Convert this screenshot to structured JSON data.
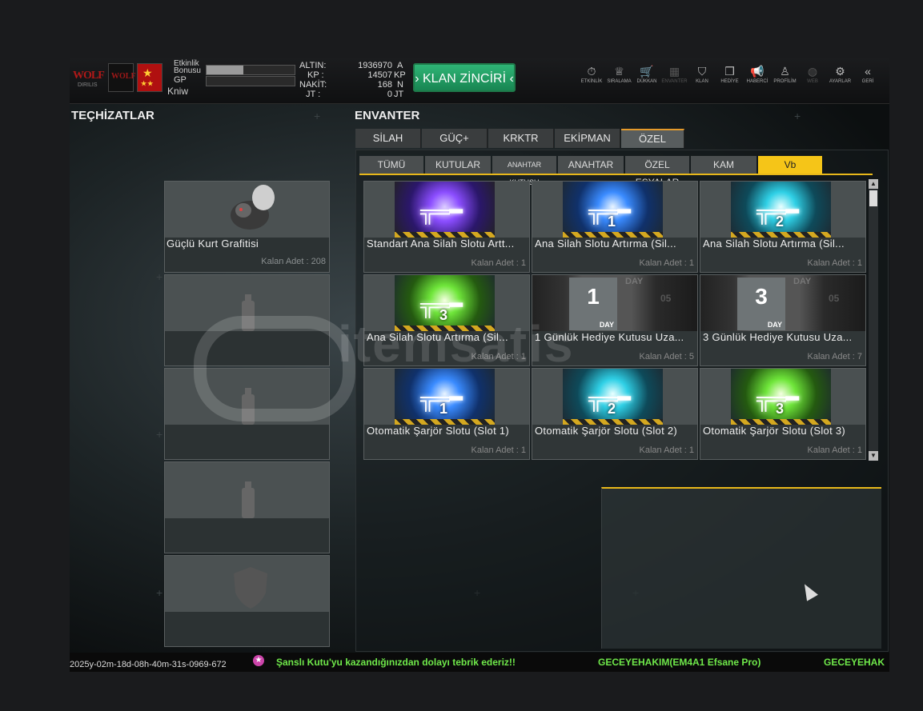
{
  "topbar": {
    "logo_text": "WOLF",
    "logo_sub": "DIRILIS",
    "logo2_text": "WOLF",
    "bonus_label": "Etkinlik Bonusu",
    "gp_label": "GP",
    "username": "Kniw",
    "bonus_progress": 0.42,
    "gp_progress": 0.0,
    "currencies": [
      {
        "label": "ALTIN:",
        "value": "1936970",
        "unit": "A"
      },
      {
        "label": "KP :",
        "value": "14507",
        "unit": "KP"
      },
      {
        "label": "NAKİT:",
        "value": "168",
        "unit": "N"
      },
      {
        "label": "JT :",
        "value": "0",
        "unit": "JT"
      }
    ],
    "klan_button": "› KLAN ZİNCİRİ ‹",
    "nav": [
      {
        "label": "ETKİNLİK",
        "icon": "stopwatch-icon",
        "glyph": "⏱",
        "enabled": true
      },
      {
        "label": "SIRALAMA",
        "icon": "medal-icon",
        "glyph": "♕",
        "enabled": true
      },
      {
        "label": "DÜKKAN",
        "icon": "cart-icon",
        "glyph": "🛒",
        "enabled": true
      },
      {
        "label": "ENVANTER",
        "icon": "inventory-icon",
        "glyph": "▦",
        "enabled": false
      },
      {
        "label": "KLAN",
        "icon": "shield-icon",
        "glyph": "⛉",
        "enabled": true
      },
      {
        "label": "HEDİYE",
        "icon": "gift-icon",
        "glyph": "❒",
        "enabled": true
      },
      {
        "label": "HABERCİ",
        "icon": "megaphone-icon",
        "glyph": "📢",
        "enabled": true
      },
      {
        "label": "PROFİLİM",
        "icon": "profile-icon",
        "glyph": "♙",
        "enabled": true
      },
      {
        "label": "WEB",
        "icon": "globe-icon",
        "glyph": "◍",
        "enabled": false
      },
      {
        "label": "AYARLAR",
        "icon": "gear-icon",
        "glyph": "⚙",
        "enabled": true
      },
      {
        "label": "GERİ",
        "icon": "back-chevrons-icon",
        "glyph": "«",
        "enabled": true
      }
    ]
  },
  "equipment": {
    "title": "TEÇHİZATLAR",
    "slots": [
      {
        "name": "Güçlü Kurt Grafitisi",
        "count": "Kalan Adet : 208"
      },
      {
        "name": "",
        "count": ""
      },
      {
        "name": "",
        "count": ""
      },
      {
        "name": "",
        "count": ""
      },
      {
        "name": "",
        "count": ""
      }
    ]
  },
  "inventory": {
    "title": "ENVANTER",
    "tabs": [
      "SİLAH",
      "GÜÇ+",
      "KRKTR",
      "EKİPMAN",
      "ÖZEL"
    ],
    "active_tab": 4,
    "subtabs": [
      "TÜMÜ",
      "KUTULAR",
      "ANAHTAR KUTUSU",
      "ANAHTAR",
      "ÖZEL EŞYALAR",
      "KAM",
      "Vb"
    ],
    "active_subtab": 6,
    "items": [
      {
        "name": "Standart Ana Silah Slotu Artt...",
        "count": "Kalan Adet : 1",
        "style": "purple",
        "badge": ""
      },
      {
        "name": "Ana Silah Slotu Artırma (Sil...",
        "count": "Kalan Adet : 1",
        "style": "blue",
        "badge": "1"
      },
      {
        "name": "Ana Silah Slotu Artırma (Sil...",
        "count": "Kalan Adet : 1",
        "style": "cyan",
        "badge": "2"
      },
      {
        "name": "Ana Silah Slotu Artırma (Sil...",
        "count": "Kalan Adet : 1",
        "style": "green",
        "badge": "3"
      },
      {
        "name": "1 Günlük Hediye Kutusu Uza...",
        "count": "Kalan Adet : 5",
        "style": "day",
        "badge": "1"
      },
      {
        "name": "3 Günlük Hediye Kutusu Uza...",
        "count": "Kalan Adet : 7",
        "style": "day",
        "badge": "3"
      },
      {
        "name": "Otomatik Şarjör Slotu (Slot 1)",
        "count": "Kalan Adet : 1",
        "style": "blue",
        "badge": "1"
      },
      {
        "name": "Otomatik Şarjör Slotu (Slot 2)",
        "count": "Kalan Adet : 1",
        "style": "cyan",
        "badge": "2"
      },
      {
        "name": "Otomatik Şarjör Slotu (Slot 3)",
        "count": "Kalan Adet : 1",
        "style": "green",
        "badge": "3"
      }
    ],
    "day_labels": {
      "top": "DAY",
      "side": "05",
      "box": "DAY"
    }
  },
  "watermark": "itemsatis",
  "ticker": {
    "timestamp": "2025y-02m-18d-08h-40m-31s-0969-672",
    "message1": "Şanslı Kutu'yu kazandığınızdan dolayı tebrik ederiz!!",
    "message2": "GECEYEHAKIM(EM4A1 Efsane Pro)",
    "message3": "GECEYEHAK"
  },
  "colors": {
    "accent": "#e8b81a",
    "klan_green": "#2fb576",
    "ticker_green": "#6fe84a"
  }
}
